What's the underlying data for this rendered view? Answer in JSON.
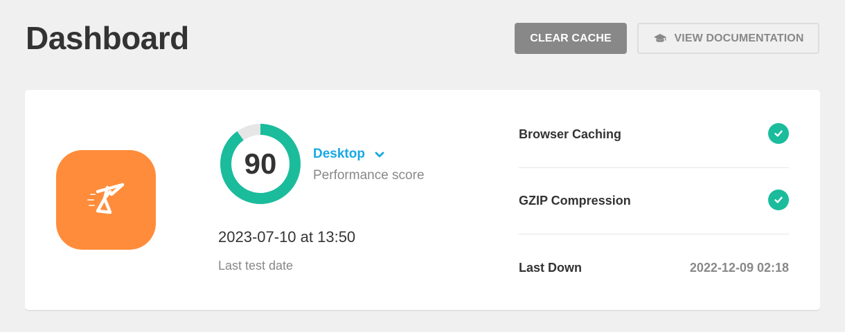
{
  "header": {
    "title": "Dashboard",
    "clear_cache_label": "CLEAR CACHE",
    "view_docs_label": "VIEW DOCUMENTATION",
    "view_docs_icon": "graduation-cap-icon"
  },
  "performance": {
    "score": "90",
    "score_fraction": 0.9,
    "device": "Desktop",
    "score_label": "Performance score",
    "test_date": "2023-07-10 at 13:50",
    "test_date_label": "Last test date"
  },
  "status": {
    "items": [
      {
        "label": "Browser Caching",
        "state": "enabled",
        "icon": "check-circle-icon"
      },
      {
        "label": "GZIP Compression",
        "state": "enabled",
        "icon": "check-circle-icon"
      },
      {
        "label": "Last Down",
        "value": "2022-12-09 02:18"
      }
    ]
  },
  "colors": {
    "accent_green": "#1abc9c",
    "link_blue": "#17a8e3",
    "logo_orange": "#ff8c3a",
    "button_gray": "#888888"
  }
}
